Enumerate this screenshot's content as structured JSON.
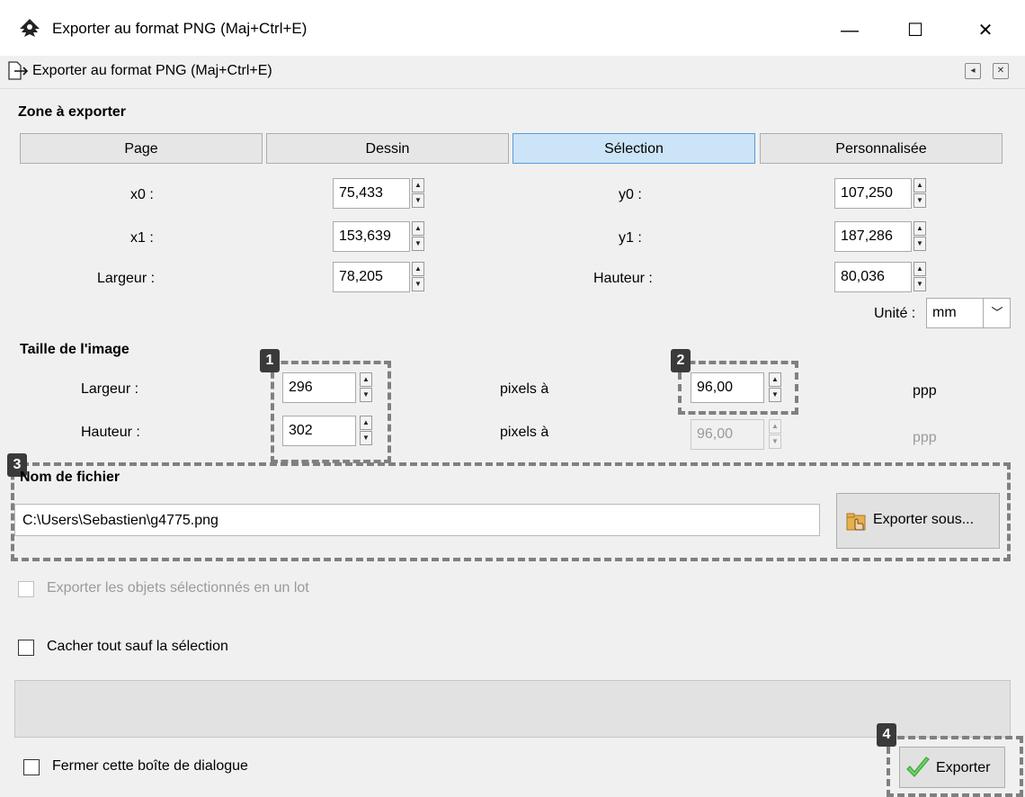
{
  "window": {
    "title": "Exporter au format PNG (Maj+Ctrl+E)",
    "min_glyph": "—",
    "max_glyph": "☐",
    "close_glyph": "✕"
  },
  "panel": {
    "title": "Exporter au format PNG (Maj+Ctrl+E)",
    "dock_glyph": "◂",
    "close_glyph": "✕"
  },
  "export_area": {
    "section_title": "Zone à exporter",
    "buttons": [
      {
        "label": "Page",
        "active": false
      },
      {
        "label": "Dessin",
        "active": false
      },
      {
        "label": "Sélection",
        "active": true
      },
      {
        "label": "Personnalisée",
        "active": false
      }
    ],
    "x0_label": "x0 :",
    "x0": "75,433",
    "y0_label": "y0 :",
    "y0": "107,250",
    "x1_label": "x1 :",
    "x1": "153,639",
    "y1_label": "y1 :",
    "y1": "187,286",
    "width_label": "Largeur :",
    "width": "78,205",
    "height_label": "Hauteur :",
    "height": "80,036",
    "unit_label": "Unité :",
    "unit": "mm"
  },
  "image_size": {
    "section_title": "Taille de l'image",
    "width_label": "Largeur :",
    "width_px": "296",
    "height_label": "Hauteur :",
    "height_px": "302",
    "pixels_at": "pixels à",
    "dpi": "96,00",
    "dpi_disabled": "96,00",
    "dpi_unit": "ppp"
  },
  "filename": {
    "section_title": "Nom de fichier",
    "value": "C:\\Users\\Sebastien\\g4775.png",
    "export_as_label": "Exporter sous..."
  },
  "options": {
    "batch_export": "Exporter les objets sélectionnés en un lot",
    "hide_all": "Cacher tout sauf la sélection",
    "close_dialog": "Fermer cette boîte de dialogue"
  },
  "export_label": "Exporter",
  "badges": [
    "1",
    "2",
    "3",
    "4"
  ],
  "colors": {
    "active_button": "#cce4f7",
    "callout_dash": "#808080",
    "checkmark_green": "#3aa536"
  }
}
